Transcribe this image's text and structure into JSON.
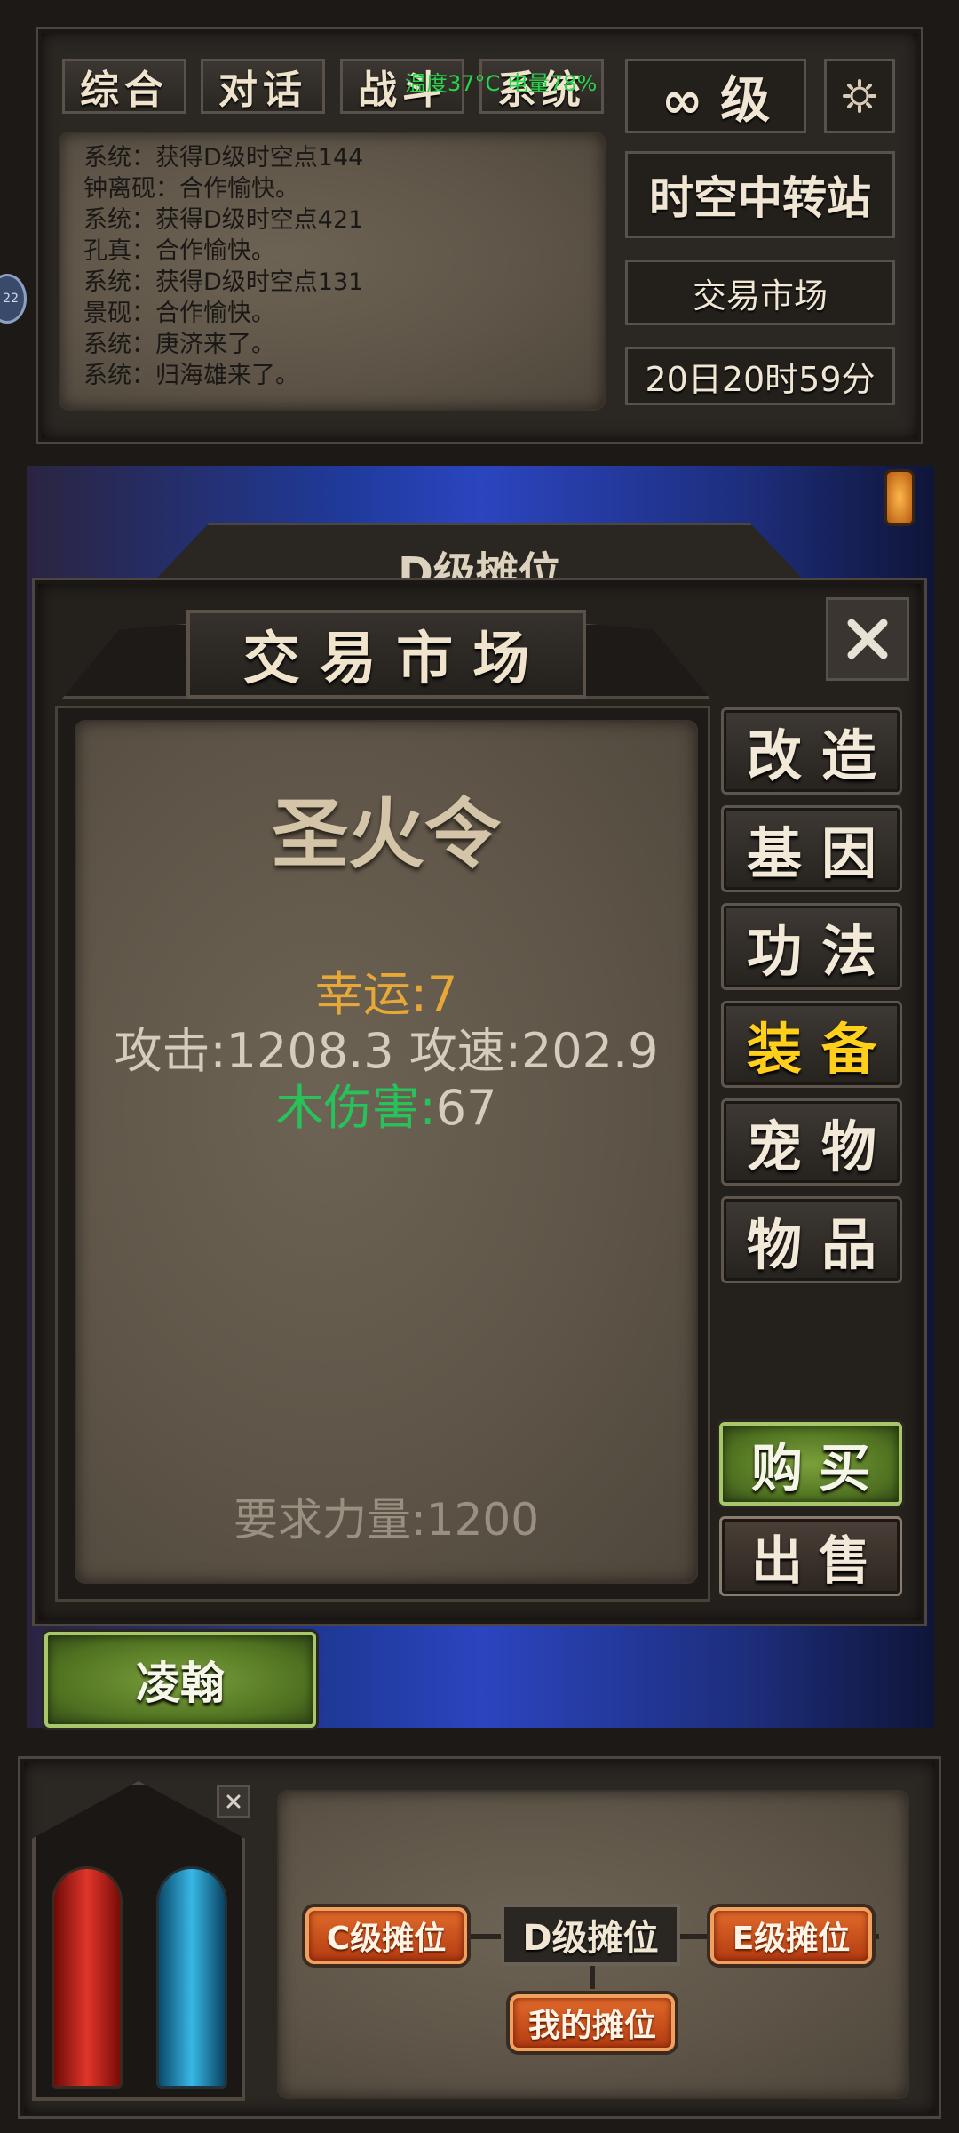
{
  "chat": {
    "tabs": [
      "综合",
      "对话",
      "战斗",
      "系统"
    ],
    "status_overlay": "温度37°C 电量78%",
    "messages": [
      "系统：获得D级时空点144",
      "钟离砚：合作愉快。",
      "系统：获得D级时空点421",
      "孔真：合作愉快。",
      "系统：获得D级时空点131",
      "景砚：合作愉快。",
      "系统：庚济来了。",
      "系统：归海雄来了。"
    ],
    "side_bubble": "22"
  },
  "header": {
    "level": "∞ 级",
    "location": "时空中转站",
    "area": "交易市场",
    "time": "20日20时59分"
  },
  "background_banner": {
    "title": "D级摊位"
  },
  "market": {
    "title": "交 易 市 场",
    "categories": [
      {
        "label": "改造",
        "active": false
      },
      {
        "label": "基因",
        "active": false
      },
      {
        "label": "功法",
        "active": false
      },
      {
        "label": "装备",
        "active": true
      },
      {
        "label": "宠物",
        "active": false
      },
      {
        "label": "物品",
        "active": false
      }
    ],
    "buy_label": "购买",
    "sell_label": "出售"
  },
  "item": {
    "name": "圣火令",
    "luck": "幸运:7",
    "attack_line": "攻击:1208.3 攻速:202.9",
    "wood_label": "木伤害:",
    "wood_value": "67",
    "requirement": "要求力量:1200"
  },
  "seller": {
    "name": "凌翰"
  },
  "stalls": {
    "c_label": "C级摊位",
    "d_label": "D级摊位",
    "e_label": "E级摊位",
    "mine_label": "我的摊位"
  },
  "colors": {
    "luck": "#e8a838",
    "wood": "#28c25a",
    "active_category": "#ffcf1a",
    "hp": "#c0211b",
    "mp": "#2a9fcf"
  }
}
